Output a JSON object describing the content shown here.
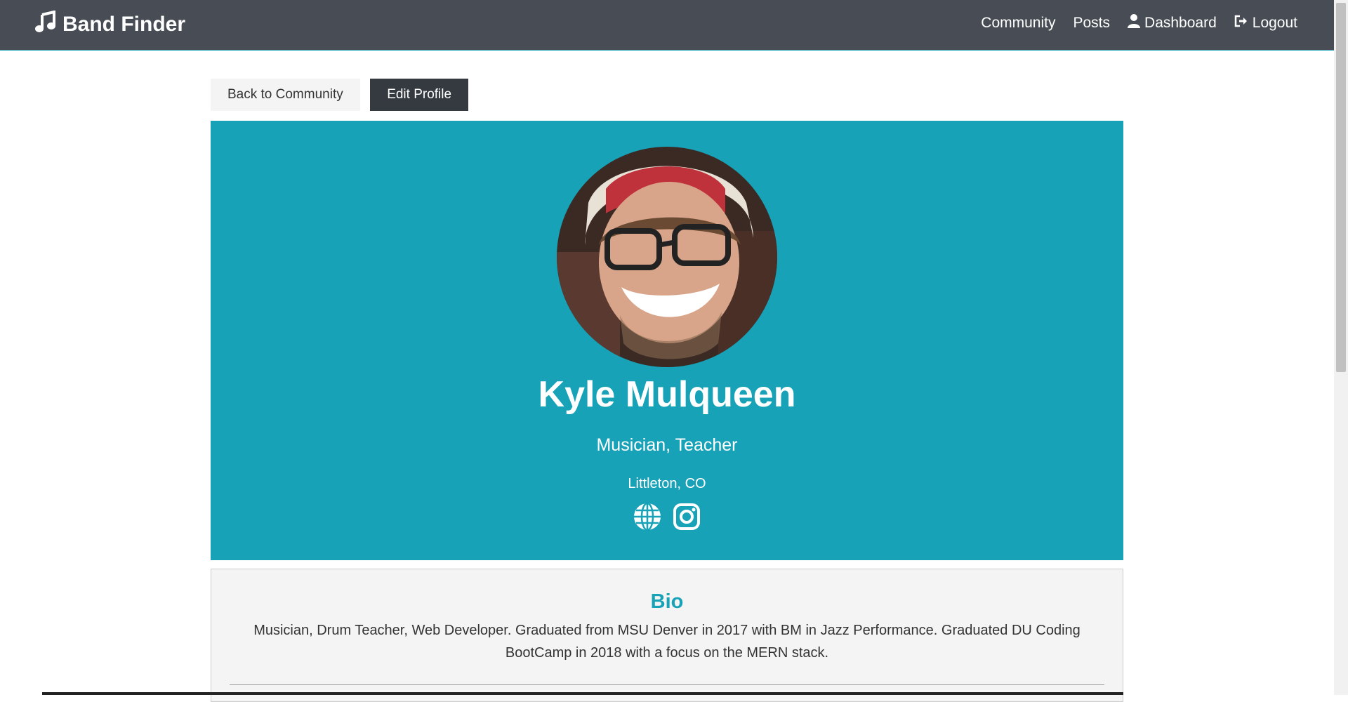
{
  "nav": {
    "brand": "Band Finder",
    "links": [
      "Community",
      "Posts",
      "Dashboard",
      "Logout"
    ]
  },
  "actions": {
    "back_label": "Back to Community",
    "edit_label": "Edit Profile"
  },
  "profile": {
    "name": "Kyle Mulqueen",
    "status": "Musician, Teacher",
    "location": "Littleton, CO",
    "social_icons": [
      "globe-icon",
      "instagram-icon"
    ]
  },
  "about": {
    "title": "Bio",
    "text": "Musician, Drum Teacher, Web Developer. Graduated from MSU Denver in 2017 with BM in Jazz Performance. Graduated DU Coding BootCamp in 2018 with a focus on the MERN stack."
  },
  "colors": {
    "navbar": "#484d55",
    "accent": "#17a2b8",
    "dark_button": "#343a40",
    "light_bg": "#f4f4f4"
  }
}
